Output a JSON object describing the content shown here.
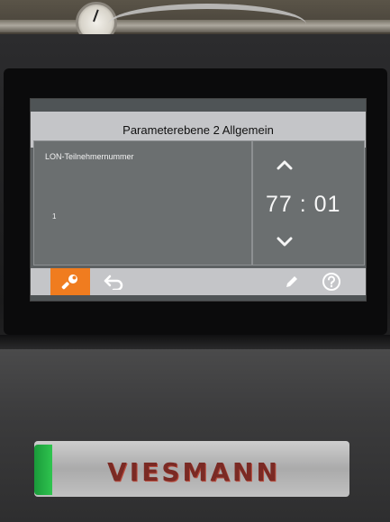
{
  "screen": {
    "title": "Parameterebene 2 Allgemein",
    "parameter_label": "LON-Teilnehmernummer",
    "parameter_index": "1",
    "value": "77 : 01"
  },
  "icons": {
    "up": "chevron-up-icon",
    "down": "chevron-down-icon",
    "service": "wrench-icon",
    "back": "back-arrow-icon",
    "edit": "pencil-icon",
    "help": "help-icon"
  },
  "brand": {
    "logo_text": "VIESMANN"
  },
  "colors": {
    "screen_background": "#5d6163",
    "bar_background": "#c4c5c8",
    "active_button": "#f07c1f",
    "logo_green": "#2fc44f",
    "logo_red": "#7a2a24"
  }
}
